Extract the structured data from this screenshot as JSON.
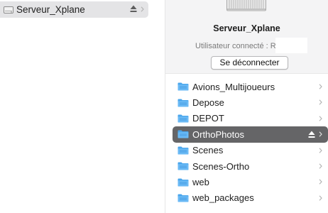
{
  "sidebar": {
    "server_label": "Serveur_Xplane"
  },
  "preview": {
    "server_name": "Serveur_Xplane",
    "user_line": "Utilisateur connecté : Ro",
    "disconnect_label": "Se déconnecter"
  },
  "folders": [
    {
      "label": "Avions_Multijoueurs"
    },
    {
      "label": "Depose"
    },
    {
      "label": "DEPOT"
    },
    {
      "label": "OrthoPhotos",
      "selected": true
    },
    {
      "label": "Scenes"
    },
    {
      "label": "Scenes-Ortho"
    },
    {
      "label": "web"
    },
    {
      "label": "web_packages"
    }
  ],
  "colors": {
    "selection": "#656567",
    "folder_blue": "#4aa6ec",
    "sidebar_selection": "#e4e4e6"
  },
  "icons": {
    "server": "server-icon",
    "eject": "eject-icon",
    "chevron": "chevron-right-icon",
    "folder": "folder-icon"
  }
}
